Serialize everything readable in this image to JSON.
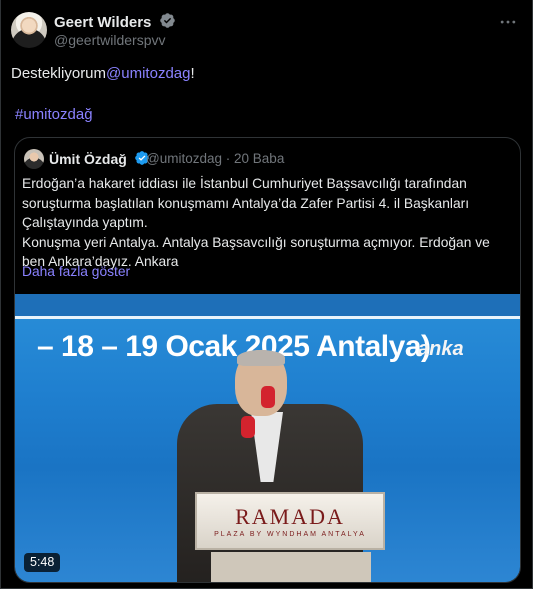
{
  "author": {
    "name": "Geert Wilders",
    "handle": "@geertwilderspvv"
  },
  "tweet": {
    "text_prefix": "Destekliyorum",
    "mention": "@umitozdag",
    "text_suffix": "!",
    "hashtag": "#umitozdağ"
  },
  "quoted": {
    "name": "Ümit Özdağ",
    "handle": "@umitozdag",
    "separator": "·",
    "time": "20 Baba",
    "text": "Erdoğan’a hakaret iddiası ile İstanbul Cumhuriyet Başsavcılığı tarafından\nsoruşturma başlatılan konuşmamı Antalya’da Zafer Partisi 4. il Başkanları\nÇalıştayında yaptım.\nKonuşma yeri Antalya. Antalya Başsavcılığı soruşturma açmıyor. Erdoğan ve\nben Ankara’dayız. Ankara",
    "show_more": "Daha fazla göster",
    "video": {
      "banner": "– 18 – 19 Ocak 2025 Antalya)",
      "watermark": "anka",
      "podium_logo": "RAMADA",
      "podium_sub": "PLAZA BY WYNDHAM\nANTALYA",
      "duration": "5:48"
    }
  },
  "colors": {
    "background": "#000000",
    "text": "#e7e9ea",
    "muted": "#71767b",
    "link": "#8a82ff",
    "verified": "#1d9bf0"
  }
}
